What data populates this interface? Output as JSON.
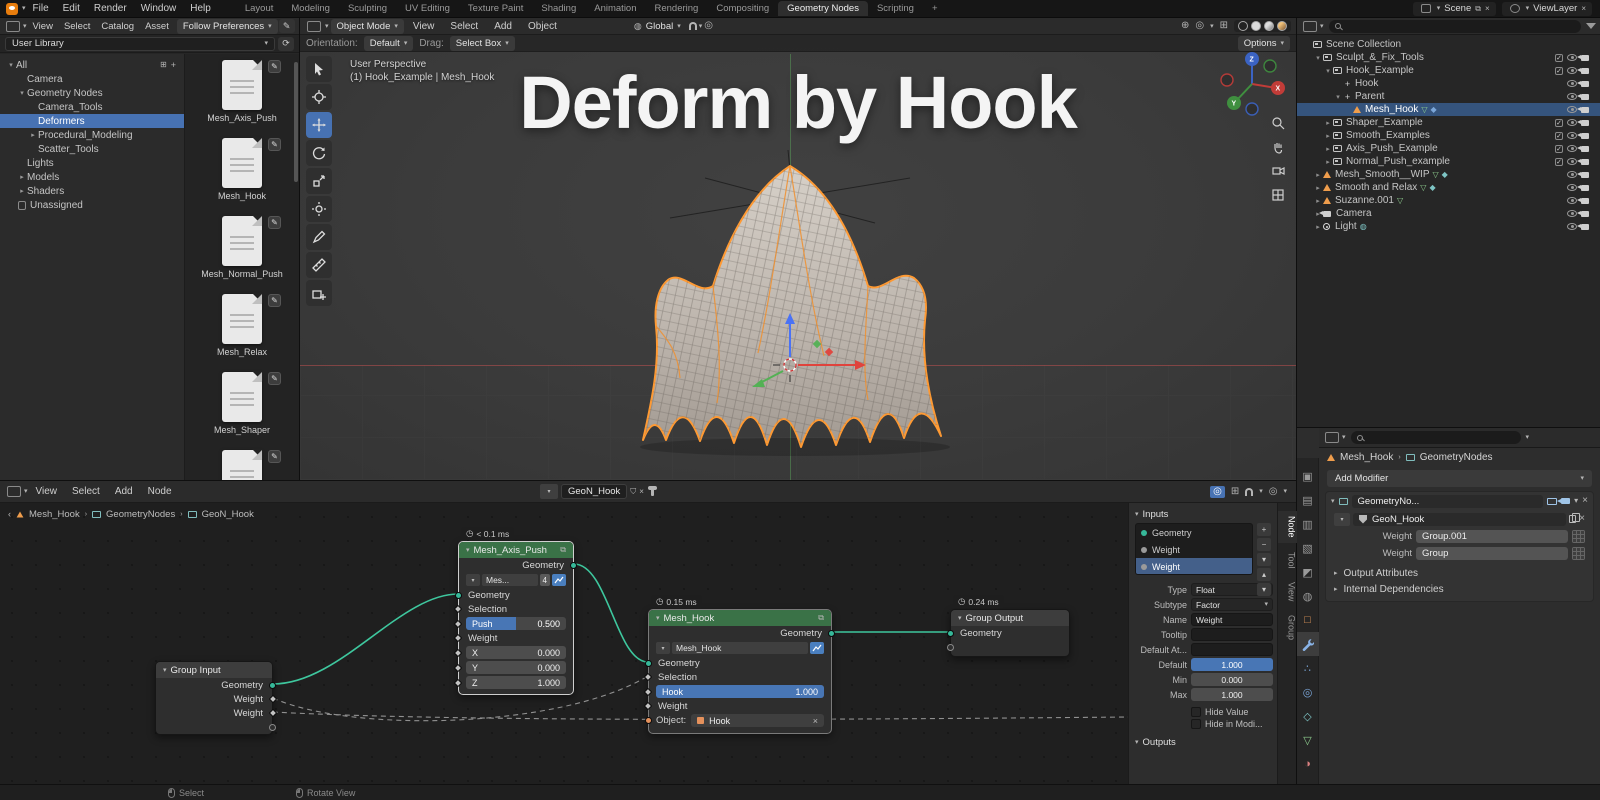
{
  "icons": {
    "chevron_down": "▾",
    "chevron_right": "▸",
    "close": "×",
    "plus": "+",
    "minus": "−",
    "up": "▴",
    "down": "▾",
    "clock": "◷",
    "pencil": "✎",
    "sep": "›"
  },
  "topbar": {
    "app_menus": [
      "File",
      "Edit",
      "Render",
      "Window",
      "Help"
    ],
    "workspaces": [
      "Layout",
      "Modeling",
      "Sculpting",
      "UV Editing",
      "Texture Paint",
      "Shading",
      "Animation",
      "Rendering",
      "Compositing",
      "Geometry Nodes",
      "Scripting"
    ],
    "active_workspace": "Geometry Nodes",
    "add_workspace": "+",
    "scene_name": "Scene",
    "viewlayer_name": "ViewLayer"
  },
  "asset_browser": {
    "menus": [
      "View",
      "Select",
      "Catalog",
      "Asset"
    ],
    "follow_button": "Follow Preferences",
    "library_selector": "User Library",
    "catalog_tree": [
      {
        "arrow": "▾",
        "label": "All",
        "depth": 0
      },
      {
        "arrow": "",
        "label": "Camera",
        "depth": 1
      },
      {
        "arrow": "▾",
        "label": "Geometry Nodes",
        "depth": 1
      },
      {
        "arrow": "",
        "label": "Camera_Tools",
        "depth": 2
      },
      {
        "arrow": "",
        "label": "Deformers",
        "depth": 2
      },
      {
        "arrow": "▸",
        "label": "Procedural_Modeling",
        "depth": 2
      },
      {
        "arrow": "",
        "label": "Scatter_Tools",
        "depth": 2
      },
      {
        "arrow": "",
        "label": "Lights",
        "depth": 1
      },
      {
        "arrow": "▸",
        "label": "Models",
        "depth": 1
      },
      {
        "arr ow": "",
        "label": "",
        "depth": 0
      },
      {
        "arrow": "▸",
        "label": "Shaders",
        "depth": 1
      },
      {
        "arrow": "",
        "label": "Unassigned",
        "depth": 0
      }
    ],
    "selected_catalog": "Deformers",
    "assets": [
      {
        "name": "Mesh_Axis_Push"
      },
      {
        "name": "Mesh_Hook"
      },
      {
        "name": "Mesh_Normal_Push"
      },
      {
        "name": "Mesh_Relax"
      },
      {
        "name": "Mesh_Shaper"
      },
      {
        "name": ""
      }
    ]
  },
  "viewport": {
    "mode_selector": "Object Mode",
    "menus": [
      "View",
      "Select",
      "Add",
      "Object"
    ],
    "orientation_selector": "Global",
    "tool_settings": {
      "orientation_label": "Orientation:",
      "orientation_value": "Default",
      "drag_label": "Drag:",
      "drag_value": "Select Box"
    },
    "options_button": "Options",
    "info_line1": "User Perspective",
    "info_line2": "(1) Hook_Example | Mesh_Hook",
    "title_overlay": "Deform by Hook",
    "axis_labels": {
      "x": "X",
      "y": "Y",
      "z": "Z"
    }
  },
  "outliner": {
    "rows": [
      {
        "arrow": "",
        "label": "Scene Collection",
        "depth": 0
      },
      {
        "arrow": "▾",
        "label": "Sculpt_&_Fix_Tools",
        "depth": 1
      },
      {
        "arrow": "▾",
        "label": "Hook_Example",
        "depth": 2
      },
      {
        "arrow": "",
        "label": "Hook",
        "depth": 3
      },
      {
        "arrow": "▾",
        "label": "Parent",
        "depth": 3
      },
      {
        "arrow": "",
        "label": "Mesh_Hook",
        "depth": 4
      },
      {
        "arrow": "▸",
        "label": "Shaper_Example",
        "depth": 2
      },
      {
        "arrow": "▸",
        "label": "Smooth_Examples",
        "depth": 2
      },
      {
        "arrow": "▸",
        "label": "Axis_Push_Example",
        "depth": 2
      },
      {
        "arrow": "▸",
        "label": "Normal_Push_example",
        "depth": 2
      },
      {
        "arrow": "▸",
        "label": "Mesh_Smooth__WIP",
        "depth": 1
      },
      {
        "arrow": "▸",
        "label": "Smooth and Relax",
        "depth": 1
      },
      {
        "arrow": "▸",
        "label": "Suzanne.001",
        "depth": 1
      },
      {
        "arrow": "▸",
        "label": "Camera",
        "depth": 1
      },
      {
        "arrow": "▸",
        "label": "Light",
        "depth": 1
      }
    ]
  },
  "properties": {
    "breadcrumb_object": "Mesh_Hook",
    "breadcrumb_data": "GeometryNodes",
    "add_modifier_button": "Add Modifier",
    "modifier": {
      "name": "GeometryNo...",
      "node_tree": "GeoN_Hook",
      "rows": [
        {
          "label": "Weight",
          "value": "Group.001"
        },
        {
          "label": "Weight",
          "value": "Group"
        }
      ],
      "sections": [
        {
          "label": "Output Attributes"
        },
        {
          "label": "Internal Dependencies"
        }
      ]
    }
  },
  "node_editor": {
    "menus": [
      "View",
      "Select",
      "Add",
      "Node"
    ],
    "datablock_name": "GeoN_Hook",
    "path": [
      "Mesh_Hook",
      "GeometryNodes",
      "GeoN_Hook"
    ],
    "nodes": {
      "group_input": {
        "title": "Group Input",
        "outputs": [
          "Geometry",
          "Weight",
          "Weight"
        ]
      },
      "mesh_axis_push": {
        "timing": "< 0.1 ms",
        "title": "Mesh_Axis_Push",
        "output": "Geometry",
        "datablock": "Mes...",
        "users": "4",
        "input_geometry": "Geometry",
        "input_selection": "Selection",
        "push": {
          "label": "Push",
          "value": "0.500"
        },
        "weight": "Weight",
        "x": {
          "label": "X",
          "value": "0.000"
        },
        "y": {
          "label": "Y",
          "value": "0.000"
        },
        "z": {
          "label": "Z",
          "value": "1.000"
        }
      },
      "mesh_hook": {
        "timing": "0.15 ms",
        "title": "Mesh_Hook",
        "output": "Geometry",
        "datablock": "Mesh_Hook",
        "input_geometry": "Geometry",
        "input_selection": "Selection",
        "hook": {
          "label": "Hook",
          "value": "1.000"
        },
        "weight": "Weight",
        "object": {
          "label": "Object:",
          "value": "Hook"
        }
      },
      "group_output": {
        "timing": "0.24 ms",
        "title": "Group Output",
        "input": "Geometry"
      }
    },
    "sidebar": {
      "inputs_header": "Inputs",
      "outputs_header": "Outputs",
      "io_items": [
        {
          "label": "Geometry"
        },
        {
          "label": "Weight"
        },
        {
          "label": "Weight"
        }
      ],
      "fields": {
        "type": {
          "label": "Type",
          "value": "Float"
        },
        "subtype": {
          "label": "Subtype",
          "value": "Factor"
        },
        "name": {
          "label": "Name",
          "value": "Weight"
        },
        "tooltip": {
          "label": "Tooltip",
          "value": ""
        },
        "default_attr": {
          "label": "Default At...",
          "value": ""
        },
        "default": {
          "label": "Default",
          "value": "1.000"
        },
        "min": {
          "label": "Min",
          "value": "0.000"
        },
        "max": {
          "label": "Max",
          "value": "1.000"
        }
      },
      "checkboxes": [
        {
          "label": "Hide Value"
        },
        {
          "label": "Hide in Modi..."
        }
      ],
      "tabs": [
        "Node",
        "Tool",
        "View",
        "Group"
      ],
      "active_tab": "Node"
    }
  },
  "statusbar": {
    "hints": [
      "Select",
      "Rotate View"
    ]
  }
}
